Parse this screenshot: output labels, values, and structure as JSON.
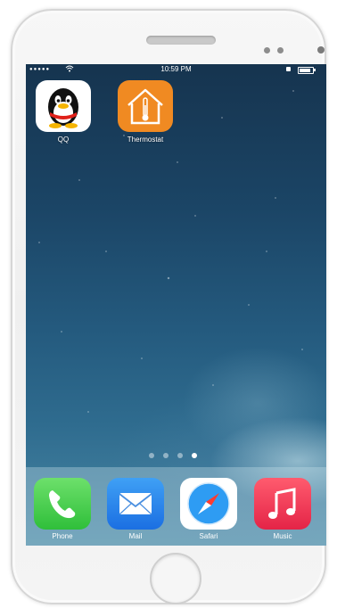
{
  "status_bar": {
    "signal": "●●●●●",
    "time": "10:59 PM"
  },
  "home_apps": [
    {
      "label": "QQ",
      "icon": "qq-penguin-icon",
      "color": "#ffffff"
    },
    {
      "label": "Thermostat",
      "icon": "thermostat-house-icon",
      "color": "#f08a22"
    }
  ],
  "page_indicator": {
    "total": 4,
    "current": 4
  },
  "dock_apps": [
    {
      "label": "Phone",
      "icon": "phone-handset-icon",
      "color": "#2fbf3a"
    },
    {
      "label": "Mail",
      "icon": "envelope-icon",
      "color": "#1b6fe2"
    },
    {
      "label": "Safari",
      "icon": "compass-icon",
      "color": "#1b8af0"
    },
    {
      "label": "Music",
      "icon": "music-note-icon",
      "color": "#e42447"
    }
  ]
}
